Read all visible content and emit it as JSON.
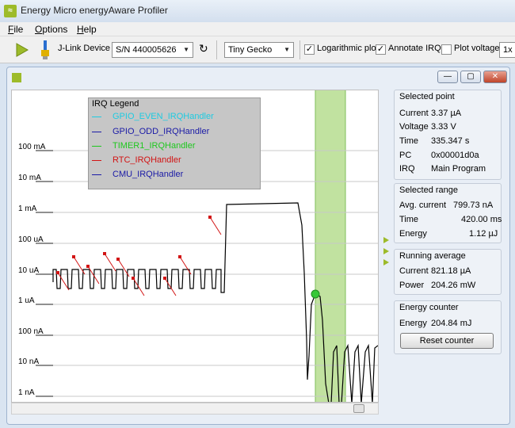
{
  "app": {
    "title": "Energy Micro energyAware Profiler"
  },
  "menu": [
    {
      "key": "F",
      "rest": "ile"
    },
    {
      "key": "O",
      "rest": "ptions"
    },
    {
      "key": "H",
      "rest": "elp"
    }
  ],
  "toolbar": {
    "jlink_label": "J-Link Device",
    "device_serial": "S/N 440005626",
    "target": "Tiny Gecko",
    "log_plot_label": "Logarithmic plot",
    "log_plot_checked": true,
    "annotate_irq_label": "Annotate IRQ",
    "annotate_irq_checked": true,
    "plot_voltage_label": "Plot voltage",
    "plot_voltage_checked": false,
    "zoom": "1x"
  },
  "plot": {
    "y_ticks": [
      "100 mA",
      "10 mA",
      "1 mA",
      "100 uA",
      "10 uA",
      "1 uA",
      "100 nA",
      "10 nA",
      "1 nA"
    ],
    "legend_title": "IRQ Legend",
    "legend": [
      {
        "name": "GPIO_EVEN_IRQHandler",
        "color": "#1ecbe1"
      },
      {
        "name": "GPIO_ODD_IRQHandler",
        "color": "#1a1aa6"
      },
      {
        "name": "TIMER1_IRQHandler",
        "color": "#1ec81e"
      },
      {
        "name": "RTC_IRQHandler",
        "color": "#d21414"
      },
      {
        "name": "CMU_IRQHandler",
        "color": "#1a1aa6"
      }
    ]
  },
  "selected_point": {
    "title": "Selected point",
    "rows": [
      {
        "label": "Current",
        "value": "3.37 µA"
      },
      {
        "label": "Voltage",
        "value": "3.33 V"
      },
      {
        "label": "Time",
        "value": "335.347 s"
      },
      {
        "label": "PC",
        "value": "0x00001d0a"
      },
      {
        "label": "IRQ",
        "value": "Main Program"
      }
    ]
  },
  "selected_range": {
    "title": "Selected range",
    "rows": [
      {
        "label": "Avg. current",
        "value": "799.73 nA"
      },
      {
        "label": "Time",
        "value": "420.00 ms"
      },
      {
        "label": "Energy",
        "value": "1.12 µJ"
      }
    ]
  },
  "running_average": {
    "title": "Running average",
    "rows": [
      {
        "label": "Current",
        "value": "821.18 µA"
      },
      {
        "label": "Power",
        "value": "204.26 mW"
      }
    ]
  },
  "energy_counter": {
    "title": "Energy counter",
    "label": "Energy",
    "value": "204.84 mJ",
    "reset_label": "Reset counter"
  },
  "colors": {
    "accent": "#9dbb2a",
    "trace": "#000000",
    "irq_marker": "#d21414",
    "selection": "#b6dd8f"
  }
}
